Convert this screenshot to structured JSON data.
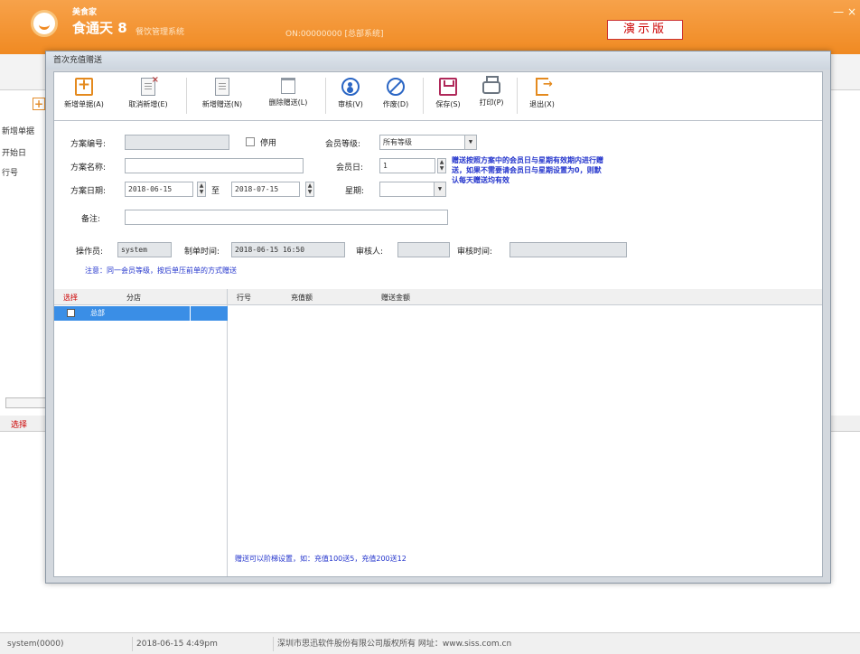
{
  "header": {
    "brand_small": "美食家",
    "brand_name": "食通天 8",
    "brand_sub": "餐饮管理系统",
    "info": "ON:00000000 [总部系统]",
    "demo_badge": "演示版",
    "window_controls": "— ×"
  },
  "background": {
    "toolbar_add": "新增单据",
    "side_labels": [
      "开始日",
      "行号"
    ],
    "grid_header": "选择"
  },
  "dialog": {
    "title": "首次充值赠送",
    "toolbar": [
      {
        "label": "新增单据(A)",
        "icon": "plus-icon"
      },
      {
        "label": "取消新增(E)",
        "icon": "cancel-doc-icon"
      },
      {
        "label": "新增赠送(N)",
        "icon": "doc-icon"
      },
      {
        "label": "删除赠送(L)",
        "icon": "trash-icon"
      },
      {
        "label": "审核(V)",
        "icon": "audit-icon"
      },
      {
        "label": "作废(D)",
        "icon": "void-icon"
      },
      {
        "label": "保存(S)",
        "icon": "save-icon"
      },
      {
        "label": "打印(P)",
        "icon": "print-icon"
      },
      {
        "label": "退出(X)",
        "icon": "exit-icon"
      }
    ],
    "form": {
      "plan_no_label": "方案编号:",
      "plan_no_value": "",
      "stop_label": "停用",
      "member_level_label": "会员等级:",
      "member_level_value": "所有等级",
      "plan_name_label": "方案名称:",
      "plan_name_value": "",
      "member_day_label": "会员日:",
      "member_day_value": "1",
      "plan_date_label": "方案日期:",
      "date_from": "2018-06-15",
      "to_label": "至",
      "date_to": "2018-07-15",
      "weekday_label": "星期:",
      "weekday_value": "",
      "note_blue": "赠送按照方案中的会员日与星期有效期内进行赠送，如果不需要请会员日与星期设置为0，则默认每天赠送均有效",
      "remark_label": "备注:",
      "remark_value": "",
      "operator_label": "操作员:",
      "operator_value": "system",
      "make_time_label": "制单时间:",
      "make_time_value": "2018-06-15 16:50",
      "auditor_label": "审核人:",
      "auditor_value": "",
      "audit_time_label": "审核时间:",
      "audit_time_value": "",
      "hint": "注意：同一会员等级，按后单压前单的方式赠送"
    },
    "grid_left": {
      "headers": [
        "选择",
        "分店"
      ],
      "rows": [
        {
          "store": "总部"
        }
      ]
    },
    "grid_right": {
      "headers": [
        "行号",
        "充值额",
        "赠送金额"
      ]
    },
    "footer_note": "赠送可以阶梯设置，如：充值100送5，充值200送12"
  },
  "statusbar": {
    "user": "system(0000)",
    "datetime": "2018-06-15 4:49pm",
    "copyright": "深圳市思迅软件股份有限公司版权所有 网址：www.siss.com.cn"
  },
  "colors": {
    "header_orange": "#f08a22",
    "accent_blue": "#2233cc",
    "select_blue": "#3a8ee6",
    "demo_red": "#cc0000"
  }
}
